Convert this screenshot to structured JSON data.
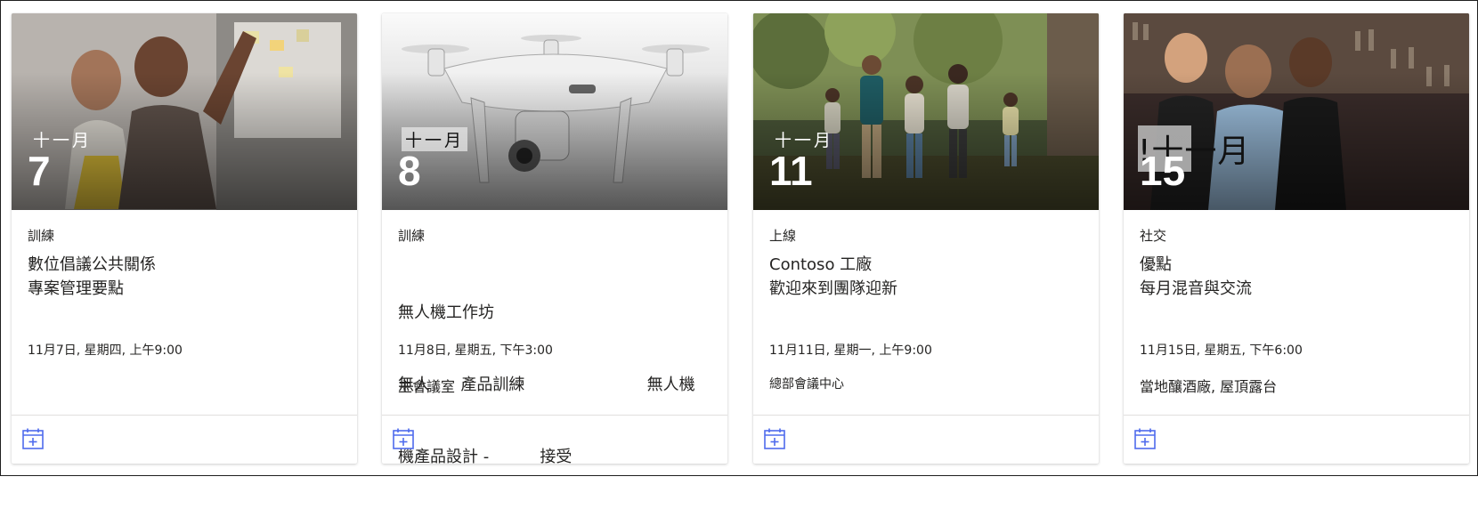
{
  "colors": {
    "accent": "#4f6bed",
    "text": "#252423",
    "divider": "#e1dfdd"
  },
  "events": [
    {
      "month": "十一月",
      "day": "7",
      "category": "訓練",
      "title_lines": [
        "數位倡議公共關係",
        "專案管理要點"
      ],
      "datetime": "11月7日, 星期四, 上午9:00",
      "location": "",
      "icon": "calendar-add-icon"
    },
    {
      "month": "十一月",
      "day": "8",
      "category": "訓練",
      "title_lines": [
        "無人機工作坊",
        "無人      產品訓練                        無人機",
        "機產品設計 -          接受"
      ],
      "datetime": "11月8日, 星期五, 下午3:00",
      "location": "主會議室",
      "icon": "calendar-add-icon"
    },
    {
      "month": "十一月",
      "day": "11",
      "category": "上線",
      "title_lines": [
        "Contoso 工廠",
        "歡迎來到團隊迎新"
      ],
      "datetime": "11月11日, 星期一, 上午9:00",
      "location": "總部會議中心",
      "icon": "calendar-add-icon"
    },
    {
      "month": "!十一月",
      "day": "15",
      "category": "社交",
      "title_lines": [
        "優點",
        "每月混音與交流"
      ],
      "datetime": "11月15日, 星期五, 下午6:00",
      "location": "當地釀酒廠, 屋頂露台",
      "icon": "calendar-add-icon"
    }
  ]
}
